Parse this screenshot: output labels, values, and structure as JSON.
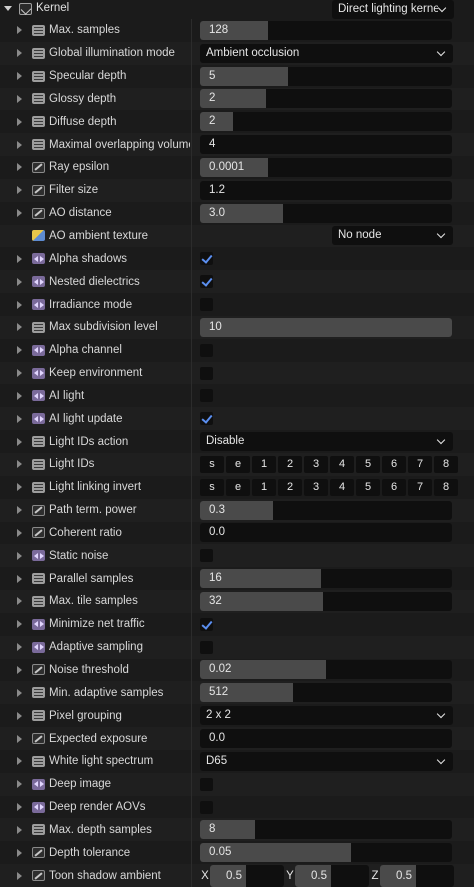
{
  "header": {
    "title": "Kernel",
    "kernel_type": "Direct lighting kerne"
  },
  "rows": [
    {
      "label": "Max. samples",
      "icon": "num",
      "kind": "slider",
      "value": "128",
      "fill": 0.27
    },
    {
      "label": "Global illumination mode",
      "icon": "enum",
      "kind": "dropdown",
      "value": "Ambient occlusion"
    },
    {
      "label": "Specular depth",
      "icon": "num",
      "kind": "slider",
      "value": "5",
      "fill": 0.35
    },
    {
      "label": "Glossy depth",
      "icon": "num",
      "kind": "slider",
      "value": "2",
      "fill": 0.26
    },
    {
      "label": "Diffuse depth",
      "icon": "num",
      "kind": "slider",
      "value": "2",
      "fill": 0.13
    },
    {
      "label": "Maximal overlapping volumes",
      "icon": "num",
      "kind": "slider",
      "value": "4",
      "fill": 0.0
    },
    {
      "label": "Ray epsilon",
      "icon": "float",
      "kind": "slider",
      "value": "0.0001",
      "fill": 0.27
    },
    {
      "label": "Filter size",
      "icon": "float",
      "kind": "slider",
      "value": "1.2",
      "fill": 0.0
    },
    {
      "label": "AO distance",
      "icon": "float",
      "kind": "slider",
      "value": "3.0",
      "fill": 0.33
    },
    {
      "label": "AO ambient texture",
      "icon": "tex",
      "kind": "node",
      "value": "No node"
    },
    {
      "label": "Alpha shadows",
      "icon": "bool",
      "kind": "check",
      "checked": true
    },
    {
      "label": "Nested dielectrics",
      "icon": "bool",
      "kind": "check",
      "checked": true
    },
    {
      "label": "Irradiance mode",
      "icon": "bool",
      "kind": "check",
      "checked": false
    },
    {
      "label": "Max subdivision level",
      "icon": "num",
      "kind": "slider",
      "value": "10",
      "fill": 1.0
    },
    {
      "label": "Alpha channel",
      "icon": "bool",
      "kind": "check",
      "checked": false
    },
    {
      "label": "Keep environment",
      "icon": "bool",
      "kind": "check",
      "checked": false
    },
    {
      "label": "AI light",
      "icon": "bool",
      "kind": "check",
      "checked": false
    },
    {
      "label": "AI light update",
      "icon": "bool",
      "kind": "check",
      "checked": true
    },
    {
      "label": "Light IDs action",
      "icon": "enum",
      "kind": "dropdown",
      "value": "Disable"
    },
    {
      "label": "Light IDs",
      "icon": "num",
      "kind": "ids",
      "buttons": [
        "s",
        "e",
        "1",
        "2",
        "3",
        "4",
        "5",
        "6",
        "7",
        "8"
      ]
    },
    {
      "label": "Light linking invert",
      "icon": "num",
      "kind": "ids",
      "buttons": [
        "s",
        "e",
        "1",
        "2",
        "3",
        "4",
        "5",
        "6",
        "7",
        "8"
      ]
    },
    {
      "label": "Path term. power",
      "icon": "float",
      "kind": "slider",
      "value": "0.3",
      "fill": 0.29
    },
    {
      "label": "Coherent ratio",
      "icon": "float",
      "kind": "slider",
      "value": "0.0",
      "fill": 0.0
    },
    {
      "label": "Static noise",
      "icon": "bool",
      "kind": "check",
      "checked": false
    },
    {
      "label": "Parallel samples",
      "icon": "num",
      "kind": "slider",
      "value": "16",
      "fill": 0.48
    },
    {
      "label": "Max. tile samples",
      "icon": "num",
      "kind": "slider",
      "value": "32",
      "fill": 0.49
    },
    {
      "label": "Minimize net traffic",
      "icon": "bool",
      "kind": "check",
      "checked": true
    },
    {
      "label": "Adaptive sampling",
      "icon": "bool",
      "kind": "check",
      "checked": false
    },
    {
      "label": "Noise threshold",
      "icon": "float",
      "kind": "slider",
      "value": "0.02",
      "fill": 0.5
    },
    {
      "label": "Min. adaptive samples",
      "icon": "num",
      "kind": "slider",
      "value": "512",
      "fill": 0.37
    },
    {
      "label": "Pixel grouping",
      "icon": "enum",
      "kind": "dropdown",
      "value": "2 x 2"
    },
    {
      "label": "Expected exposure",
      "icon": "float",
      "kind": "slider",
      "value": "0.0",
      "fill": 0.0
    },
    {
      "label": "White light spectrum",
      "icon": "enum",
      "kind": "dropdown",
      "value": "D65"
    },
    {
      "label": "Deep image",
      "icon": "bool",
      "kind": "check",
      "checked": false
    },
    {
      "label": "Deep render AOVs",
      "icon": "bool",
      "kind": "check",
      "checked": false
    },
    {
      "label": "Max. depth samples",
      "icon": "num",
      "kind": "slider",
      "value": "8",
      "fill": 0.22
    },
    {
      "label": "Depth tolerance",
      "icon": "float",
      "kind": "slider",
      "value": "0.05",
      "fill": 0.6
    },
    {
      "label": "Toon shadow ambient",
      "icon": "float",
      "kind": "xyz",
      "axes": [
        "X",
        "Y",
        "Z"
      ],
      "values": [
        "0.5",
        "0.5",
        "0.5"
      ],
      "fills": [
        0.48,
        0.48,
        0.48
      ]
    }
  ]
}
